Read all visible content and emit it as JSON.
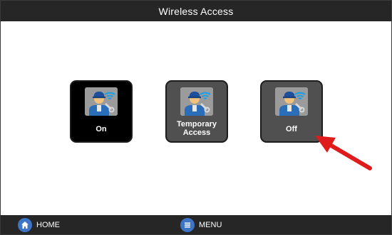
{
  "header": {
    "title": "Wireless Access"
  },
  "tiles": [
    {
      "label": "On",
      "icon": "technician-wifi-icon",
      "state": "selected"
    },
    {
      "label": "Temporary\nAccess",
      "icon": "technician-wifi-icon",
      "state": "normal"
    },
    {
      "label": "Off",
      "icon": "technician-wifi-icon",
      "state": "normal"
    }
  ],
  "annotation": {
    "arrow_color": "#e01b1b",
    "points_to": "Off"
  },
  "footer": {
    "home_label": "HOME",
    "menu_label": "MENU"
  },
  "colors": {
    "bar": "#262626",
    "tile_selected": "#000000",
    "tile_normal": "#505050",
    "nav_icon": "#3d74c6"
  }
}
